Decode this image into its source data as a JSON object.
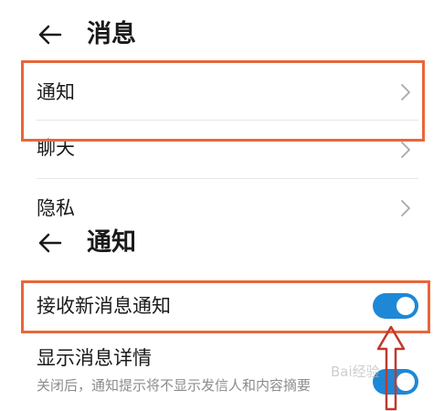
{
  "screen1": {
    "header": {
      "title": "消息"
    },
    "items": [
      {
        "label": "通知"
      },
      {
        "label": "聊天"
      },
      {
        "label": "隐私"
      }
    ]
  },
  "screen2": {
    "header": {
      "title": "通知"
    },
    "receive_toggle": {
      "label": "接收新消息通知",
      "on": true
    },
    "detail_toggle": {
      "label": "显示消息详情",
      "description": "关闭后，通知提示将不显示发信人和内容摘要",
      "on": true
    }
  },
  "watermark": {
    "text": "Bai经验"
  },
  "colors": {
    "highlight": "#e8663a",
    "toggle_on": "#1e88d6",
    "arrow": "#c0392b"
  }
}
